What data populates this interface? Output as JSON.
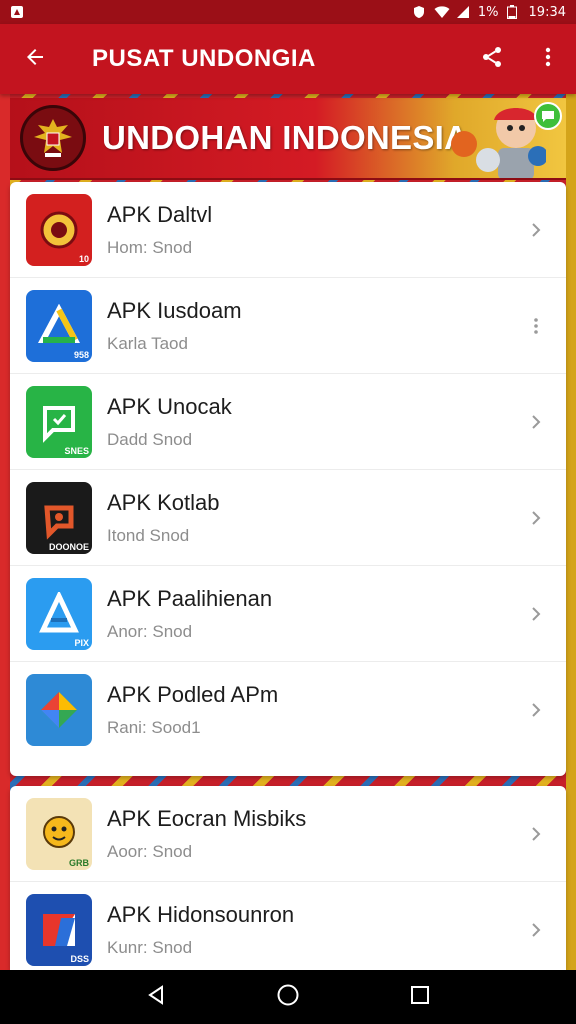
{
  "status_bar": {
    "battery": "1%",
    "time": "19:34",
    "icons": [
      "notification-icon",
      "shield-icon",
      "wifi-icon",
      "signal-icon",
      "battery-icon"
    ]
  },
  "app_bar": {
    "title": "PUSAT UNDONGIA",
    "icons": [
      "back-arrow-icon",
      "share-icon",
      "more-vert-icon"
    ]
  },
  "banner": {
    "title": "UNDOHAN INDONESIA"
  },
  "list_main": [
    {
      "title": "APK Daltvl",
      "subtitle": "Hom: Snod",
      "action": "chevron",
      "icon_color": "#d3201f",
      "icon_tag": "10"
    },
    {
      "title": "APK Iusdoam",
      "subtitle": "Karla Taod",
      "action": "more",
      "icon_color": "#1e6fd9",
      "icon_tag": "958"
    },
    {
      "title": "APK Unocak",
      "subtitle": "Dadd Snod",
      "action": "chevron",
      "icon_color": "#28b446",
      "icon_tag": "SNES"
    },
    {
      "title": "APK Kotlab",
      "subtitle": "Itond Snod",
      "action": "chevron",
      "icon_color": "#1a1a1a",
      "icon_tag": "DOONOE"
    },
    {
      "title": "APK Paalihienan",
      "subtitle": "Anor: Snod",
      "action": "chevron",
      "icon_color": "#2b9cf0",
      "icon_tag": "PIX"
    },
    {
      "title": "APK Podled APm",
      "subtitle": "Rani: Sood1",
      "action": "chevron",
      "icon_color": "#2e8ad6",
      "icon_tag": ""
    }
  ],
  "list_secondary": [
    {
      "title": "APK Eocran Misbiks",
      "subtitle": "Aoor: Snod",
      "action": "chevron",
      "icon_color": "#f3e2b5",
      "icon_tag": "GRB"
    },
    {
      "title": "APK Hidonsounron",
      "subtitle": "Kunr: Snod",
      "action": "chevron",
      "icon_color": "#1e4fb0",
      "icon_tag": "DSS"
    }
  ],
  "nav_bar": {
    "icons": [
      "back-triangle-icon",
      "home-circle-icon",
      "recents-square-icon"
    ]
  }
}
